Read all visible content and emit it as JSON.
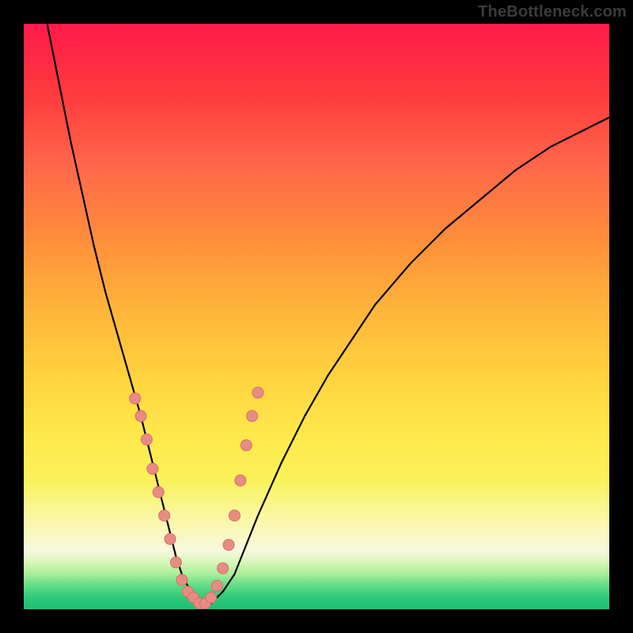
{
  "watermark": "TheBottleneck.com",
  "colors": {
    "background": "#000000",
    "curve": "#000000",
    "marker_fill": "#e98b85",
    "marker_stroke": "#d76e65"
  },
  "chart_data": {
    "type": "line",
    "title": "",
    "xlabel": "",
    "ylabel": "",
    "xlim": [
      0,
      100
    ],
    "ylim": [
      0,
      100
    ],
    "series": [
      {
        "name": "bottleneck-curve",
        "x": [
          4,
          6,
          8,
          10,
          12,
          14,
          16,
          18,
          20,
          22,
          23,
          24,
          25,
          26,
          27,
          28,
          29,
          30,
          32,
          34,
          36,
          38,
          40,
          44,
          48,
          52,
          56,
          60,
          66,
          72,
          78,
          84,
          90,
          96,
          100
        ],
        "values": [
          100,
          90,
          80,
          71,
          62,
          54,
          47,
          40,
          33,
          25,
          21,
          17,
          13,
          9,
          6,
          4,
          2,
          1,
          1,
          3,
          6,
          11,
          16,
          25,
          33,
          40,
          46,
          52,
          59,
          65,
          70,
          75,
          79,
          82,
          84
        ]
      }
    ],
    "markers": [
      {
        "x": 19,
        "y": 36
      },
      {
        "x": 20,
        "y": 33
      },
      {
        "x": 21,
        "y": 29
      },
      {
        "x": 22,
        "y": 24
      },
      {
        "x": 23,
        "y": 20
      },
      {
        "x": 24,
        "y": 16
      },
      {
        "x": 25,
        "y": 12
      },
      {
        "x": 26,
        "y": 8
      },
      {
        "x": 27,
        "y": 5
      },
      {
        "x": 28,
        "y": 3
      },
      {
        "x": 29,
        "y": 2
      },
      {
        "x": 30,
        "y": 1
      },
      {
        "x": 31,
        "y": 1
      },
      {
        "x": 32,
        "y": 2
      },
      {
        "x": 33,
        "y": 4
      },
      {
        "x": 34,
        "y": 7
      },
      {
        "x": 35,
        "y": 11
      },
      {
        "x": 36,
        "y": 16
      },
      {
        "x": 37,
        "y": 22
      },
      {
        "x": 38,
        "y": 28
      },
      {
        "x": 39,
        "y": 33
      },
      {
        "x": 40,
        "y": 37
      }
    ]
  }
}
